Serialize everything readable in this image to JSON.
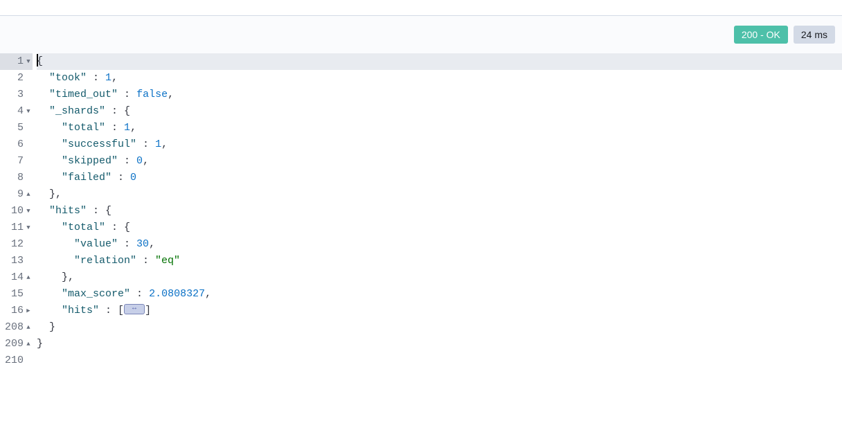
{
  "status": {
    "code_label": "200 - OK",
    "time_label": "24 ms"
  },
  "lines": {
    "l1": "1",
    "l2": "2",
    "l3": "3",
    "l4": "4",
    "l5": "5",
    "l6": "6",
    "l7": "7",
    "l8": "8",
    "l9": "9",
    "l10": "10",
    "l11": "11",
    "l12": "12",
    "l13": "13",
    "l14": "14",
    "l15": "15",
    "l16": "16",
    "l208": "208",
    "l209": "209",
    "l210": "210"
  },
  "keys": {
    "took": "\"took\"",
    "timed_out": "\"timed_out\"",
    "shards": "\"_shards\"",
    "total": "\"total\"",
    "successful": "\"successful\"",
    "skipped": "\"skipped\"",
    "failed": "\"failed\"",
    "hits": "\"hits\"",
    "value": "\"value\"",
    "relation": "\"relation\"",
    "max_score": "\"max_score\""
  },
  "values": {
    "took": "1",
    "timed_out": "false",
    "shards_total": "1",
    "shards_successful": "1",
    "shards_skipped": "0",
    "shards_failed": "0",
    "hits_total_value": "30",
    "hits_relation": "\"eq\"",
    "max_score": "2.0808327"
  },
  "punct": {
    "obrace": "{",
    "cbrace": "}",
    "cbrace_comma": "},",
    "obracket": "[",
    "cbracket": "]",
    "colon": " : ",
    "comma": ","
  }
}
